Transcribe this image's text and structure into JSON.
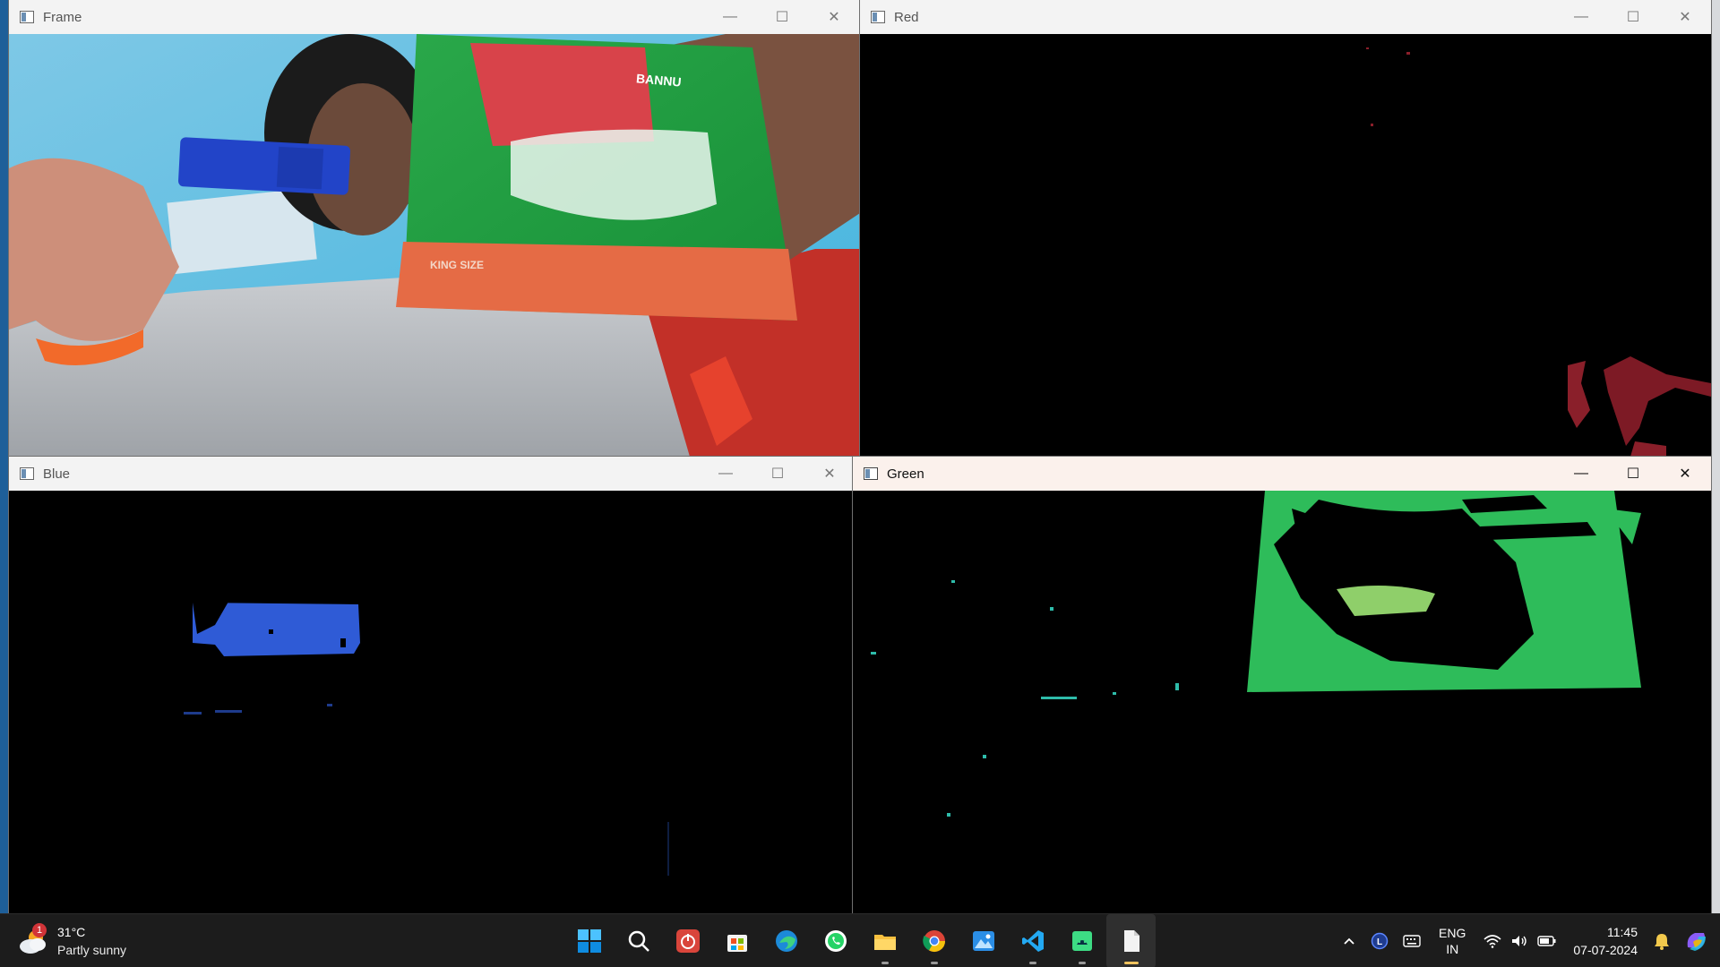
{
  "windows": {
    "frame": {
      "title": "Frame"
    },
    "red": {
      "title": "Red"
    },
    "blue": {
      "title": "Blue"
    },
    "green": {
      "title": "Green"
    }
  },
  "book_label_top": "BANNU",
  "book_label_bottom": "KING SIZE",
  "window_controls": {
    "minimize": "—",
    "maximize": "☐",
    "close": "✕"
  },
  "taskbar": {
    "weather": {
      "badge": "1",
      "temperature": "31°C",
      "condition": "Partly sunny"
    },
    "apps": [
      "start-icon",
      "search-icon",
      "power-app-icon",
      "store-icon",
      "edge-icon",
      "whatsapp-icon",
      "file-explorer-icon",
      "chrome-icon",
      "photos-icon",
      "vscode-icon",
      "android-studio-icon",
      "file-icon"
    ],
    "language": {
      "primary": "ENG",
      "secondary": "IN"
    },
    "clock": {
      "time": "11:45",
      "date": "07-07-2024"
    }
  },
  "colors": {
    "taskbar": "#1c1c1c",
    "titlebar": "#f3f3f3",
    "active_titlebar": "#fbf1ec",
    "green_mask": "#2ebc5a",
    "blue_mask": "#2f5bd6",
    "red_mask": "#8a1f2a"
  }
}
